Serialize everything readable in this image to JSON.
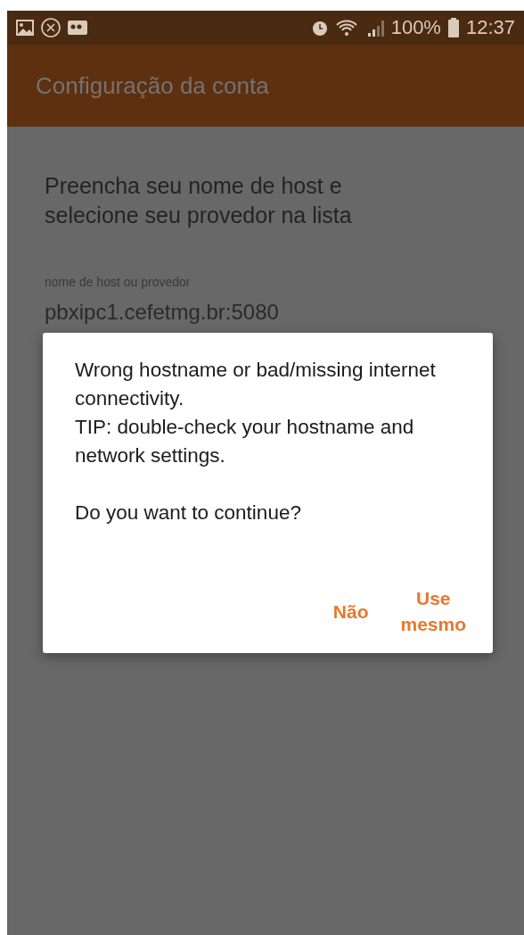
{
  "status_bar": {
    "battery": "100%",
    "time": "12:37"
  },
  "app_bar": {
    "title": "Configuração da conta"
  },
  "content": {
    "instruction": "Preencha seu nome de host e selecione seu provedor na lista",
    "field": {
      "label": "nome de host ou provedor",
      "value": "pbxipc1.cefetmg.br:5080"
    }
  },
  "dialog": {
    "message": [
      "Wrong hostname or bad/missing internet connectivity.\nTIP: double-check your hostname and network settings.",
      "Do you want to continue?"
    ],
    "buttons": [
      {
        "label": "Não"
      },
      {
        "label": "Use\nmesmo"
      }
    ]
  }
}
